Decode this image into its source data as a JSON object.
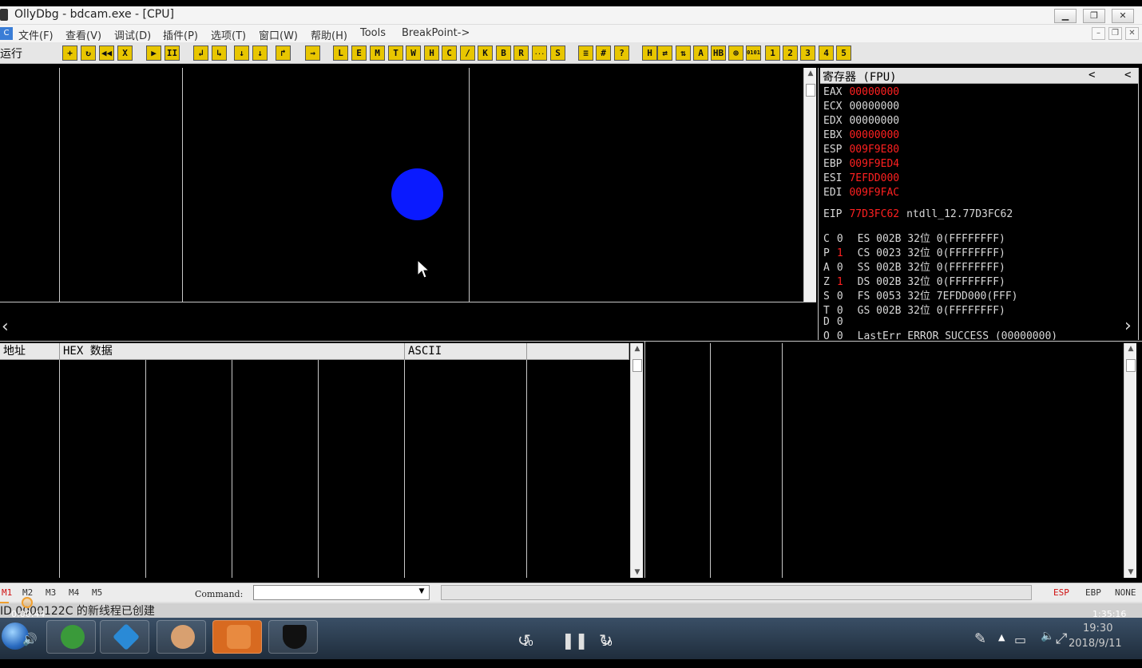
{
  "window": {
    "title": "OllyDbg - bdcam.exe - [CPU]",
    "controls": [
      "minimize-icon",
      "restore-icon",
      "close-icon"
    ]
  },
  "menu": {
    "icon": "ollydbg-icon",
    "items": [
      "文件(F)",
      "查看(V)",
      "调试(D)",
      "插件(P)",
      "选项(T)",
      "窗口(W)",
      "帮助(H)",
      "Tools",
      "BreakPoint->"
    ]
  },
  "toolbar": {
    "status_label": "运行",
    "group1": [
      "+",
      "↻",
      "◀◀",
      "X"
    ],
    "group2": [
      "▶",
      "II"
    ],
    "group3": [
      "↲",
      "↳",
      "↓",
      "↓",
      "↱"
    ],
    "group4": [
      "→"
    ],
    "group5": [
      "L",
      "E",
      "M",
      "T",
      "W",
      "H",
      "C",
      "/",
      "K",
      "B",
      "R",
      "...",
      "S"
    ],
    "group6": [
      "≡",
      "#",
      "?"
    ],
    "group7": [
      "H",
      "⇄",
      "⇅",
      "A",
      "HB",
      "⊕",
      "0101",
      "1",
      "2",
      "3",
      "4",
      "5"
    ]
  },
  "registers": {
    "header": "寄存器 (FPU)",
    "nav_prev": "<",
    "nav_prev2": "<",
    "rows": [
      {
        "name": "EAX",
        "value": "00000000",
        "changed": true
      },
      {
        "name": "ECX",
        "value": "00000000",
        "changed": false
      },
      {
        "name": "EDX",
        "value": "00000000",
        "changed": false
      },
      {
        "name": "EBX",
        "value": "00000000",
        "changed": true
      },
      {
        "name": "ESP",
        "value": "009F9E80",
        "changed": true
      },
      {
        "name": "EBP",
        "value": "009F9ED4",
        "changed": true
      },
      {
        "name": "ESI",
        "value": "7EFDD000",
        "changed": true
      },
      {
        "name": "EDI",
        "value": "009F9FAC",
        "changed": true
      }
    ],
    "eip": {
      "name": "EIP",
      "value": "77D3FC62",
      "comment": "ntdll_12.77D3FC62"
    },
    "flags": [
      {
        "flag": "C",
        "val": "0",
        "changed": false,
        "seg": "ES 002B 32位 0(FFFFFFFF)"
      },
      {
        "flag": "P",
        "val": "1",
        "changed": true,
        "seg": "CS 0023 32位 0(FFFFFFFF)"
      },
      {
        "flag": "A",
        "val": "0",
        "changed": false,
        "seg": "SS 002B 32位 0(FFFFFFFF)"
      },
      {
        "flag": "Z",
        "val": "1",
        "changed": true,
        "seg": "DS 002B 32位 0(FFFFFFFF)"
      },
      {
        "flag": "S",
        "val": "0",
        "changed": false,
        "seg": "FS 0053 32位 7EFDD000(FFF)"
      },
      {
        "flag": "T",
        "val": "0",
        "changed": false,
        "seg": "GS 002B 32位 0(FFFFFFFF)"
      },
      {
        "flag": "D",
        "val": "0",
        "changed": false,
        "seg": ""
      },
      {
        "flag": "O",
        "val": "0",
        "changed": false,
        "seg": "LastErr ERROR_SUCCESS (00000000)"
      }
    ]
  },
  "dump": {
    "col_address": "地址",
    "col_hex": "HEX 数据",
    "col_ascii": "ASCII"
  },
  "status": {
    "markers": [
      "M1",
      "M2",
      "M3",
      "M4",
      "M5"
    ],
    "command_label": "Command:",
    "command_value": "",
    "stack_modes": [
      "ESP",
      "EBP",
      "NONE"
    ],
    "log": "ID 0000122C 的新线程已创建"
  },
  "video": {
    "elapsed": "0:00:44",
    "total": "1:35:16",
    "clock_time": "19:30",
    "clock_date": "2018/9/11",
    "skip_back": "10",
    "skip_forward": "30"
  },
  "taskbar": {
    "apps": [
      "start-orb-icon",
      "volume-icon",
      "frog-app-icon",
      "media-app-icon",
      "people-app-icon",
      "pen-app-icon",
      "shield-app-icon"
    ]
  },
  "colors": {
    "changed_register": "#ff2020",
    "cursor_highlight": "#0a1aff",
    "toolbar_button": "#e8c600"
  }
}
